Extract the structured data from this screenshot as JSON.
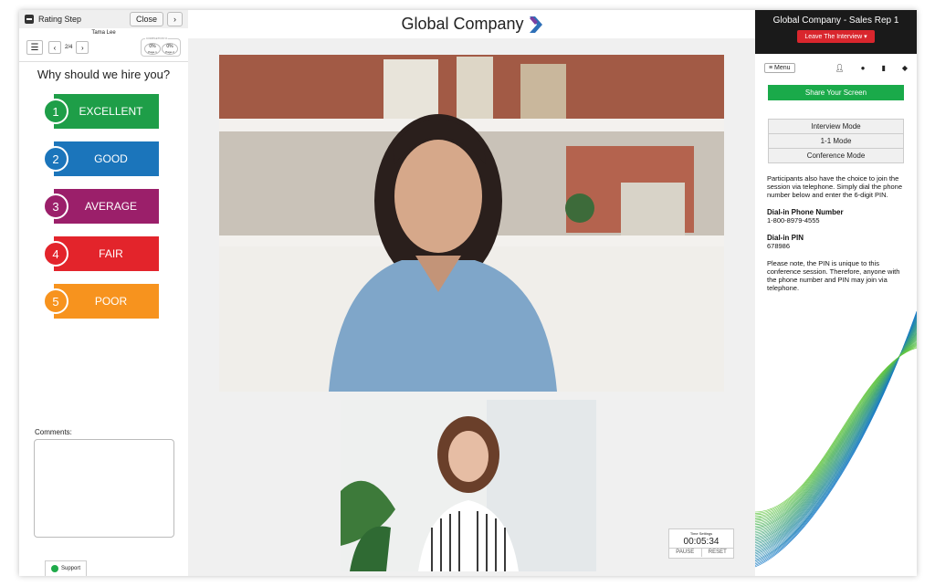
{
  "left_panel": {
    "title": "Rating Step",
    "close_label": "Close",
    "next_arrow": "›",
    "candidate_name": "Tama Lee",
    "page_indicator": "2/4",
    "completion_label": "COMPLETION %",
    "completion_values": [
      "0%",
      "0%"
    ],
    "completion_pages": [
      "Page 1",
      "Page 2"
    ],
    "question": "Why should we hire  you?",
    "ratings": [
      {
        "num": "1",
        "label": "EXCELLENT",
        "color": "#1e9e48"
      },
      {
        "num": "2",
        "label": "GOOD",
        "color": "#1b75bb"
      },
      {
        "num": "3",
        "label": "AVERAGE",
        "color": "#9b1f6a"
      },
      {
        "num": "4",
        "label": "FAIR",
        "color": "#e3242b"
      },
      {
        "num": "5",
        "label": "POOR",
        "color": "#f7931e"
      }
    ],
    "comments_label": "Comments:",
    "support_label": "Support"
  },
  "header": {
    "company": "Global Company"
  },
  "timer": {
    "label": "Time Settings",
    "value": "00:05:34",
    "pause_label": "PAUSE",
    "reset_label": "RESET"
  },
  "right_panel": {
    "title": "Global Company - Sales Rep 1",
    "leave_label": "Leave The Interview ▾",
    "menu_label": "≡ Menu",
    "share_label": "Share Your Screen",
    "modes": [
      "Interview Mode",
      "1-1 Mode",
      "Conference Mode"
    ],
    "telephone_note": "Participants also have the choice to join the session via telephone. Simply dial the phone number below and enter the 6-digit PIN.",
    "dial_in_label": "Dial-in Phone Number",
    "dial_in_number": "1-800-8979-4555",
    "pin_label": "Dial-in PIN",
    "pin_value": "678986",
    "pin_note": "Please note, the PIN is unique to this conference session.  Therefore, anyone with the phone number and PIN may join via telephone."
  }
}
